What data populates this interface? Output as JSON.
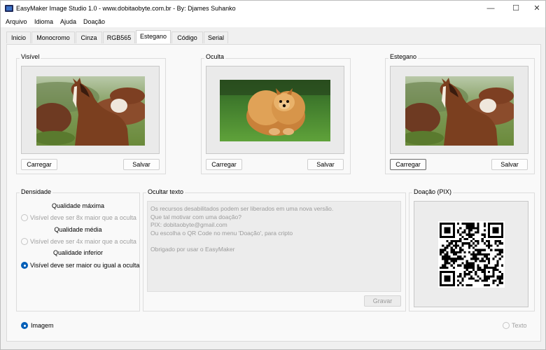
{
  "window": {
    "title": "EasyMaker Image Studio 1.0 - www.dobitaobyte.com.br - By: Djames Suhanko",
    "minimize_glyph": "—",
    "maximize_glyph": "☐",
    "close_glyph": "✕"
  },
  "menu": [
    "Arquivo",
    "Idioma",
    "Ajuda",
    "Doação"
  ],
  "tabs": [
    "Inicio",
    "Monocromo",
    "Cinza",
    "RGB565",
    "Estegano",
    "Código",
    "Serial"
  ],
  "active_tab": "Estegano",
  "visivel": {
    "title": "Visível",
    "load_label": "Carregar",
    "save_label": "Salvar",
    "image": "horse-photo"
  },
  "oculta": {
    "title": "Oculta",
    "load_label": "Carregar",
    "save_label": "Salvar",
    "image": "pomeranian-dog-photo"
  },
  "estegano": {
    "title": "Estegano",
    "load_label": "Carregar",
    "save_label": "Salvar",
    "image": "horse-photo"
  },
  "densidade": {
    "title": "Densidade",
    "options": [
      {
        "heading": "Qualidade máxima",
        "label": "Visível deve ser 8x maior que a oculta",
        "enabled": false,
        "checked": false
      },
      {
        "heading": "Qualidade média",
        "label": "Visível deve ser 4x maior que a oculta",
        "enabled": false,
        "checked": false
      },
      {
        "heading": "Qualidade inferior",
        "label": "Visível deve ser maior ou igual a oculta",
        "enabled": true,
        "checked": true
      }
    ]
  },
  "ocultar_texto": {
    "title": "Ocultar texto",
    "text": "Os recursos desabilitados podem ser liberados em uma nova versão.\nQue tal motivar com uma doação?\nPIX: dobitaobyte@gmail.com\nOu escolha o QR Code no menu 'Doação', para cripto\n\nObrigado por usar o EasyMaker",
    "save_label": "Gravar"
  },
  "doacao": {
    "title": "Doação (PIX)",
    "image": "pix-qr-code"
  },
  "mode": {
    "image_label": "Imagem",
    "image_checked": true,
    "text_label": "Texto",
    "text_checked": false
  },
  "colors": {
    "accent": "#005fb8",
    "disabled_text": "#9b9b9b",
    "page_bg": "#f9f9f9"
  }
}
